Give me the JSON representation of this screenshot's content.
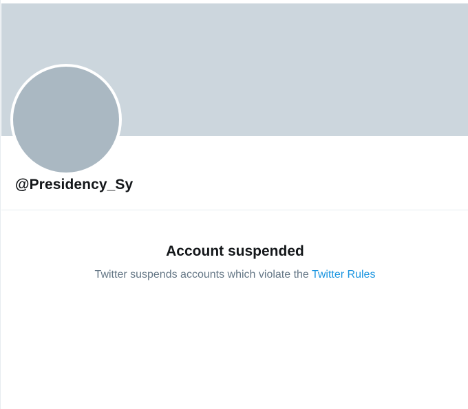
{
  "profile": {
    "handle": "@Presidency_Sy",
    "avatar_color": "#aab8c2",
    "banner_color": "#ccd6dd"
  },
  "suspension": {
    "title": "Account suspended",
    "message": "Twitter suspends accounts which violate the",
    "link_label": "Twitter Rules",
    "link_color": "#1b95e0"
  }
}
